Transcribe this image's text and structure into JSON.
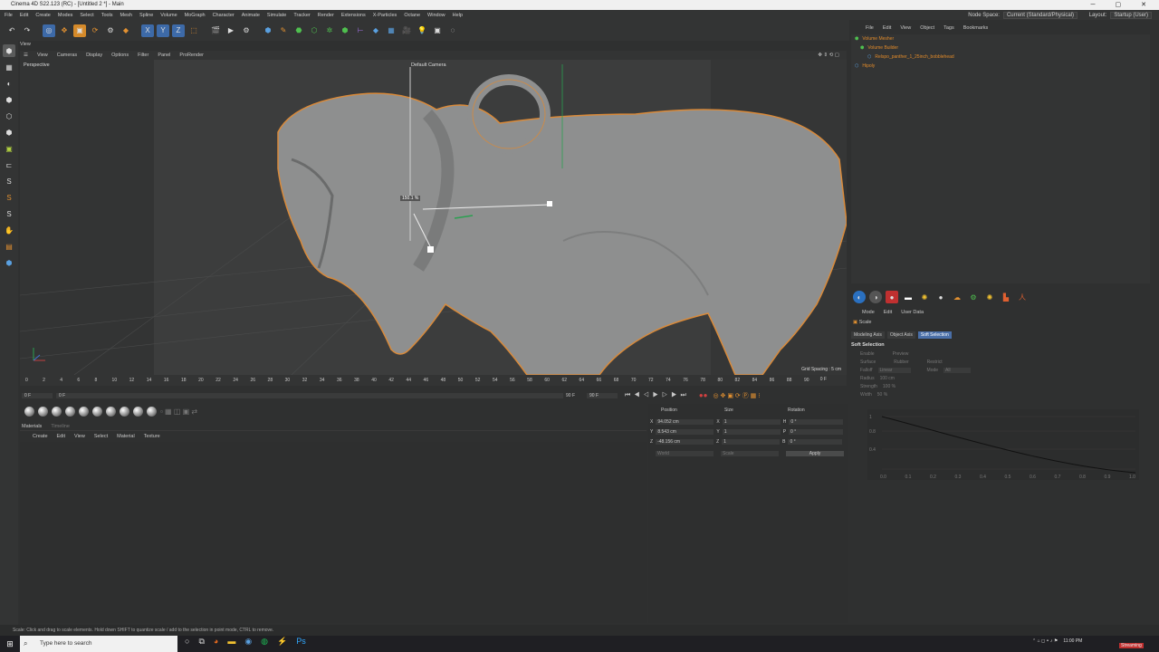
{
  "window": {
    "title": "Cinema 4D S22.123 (RC) - [Untitled 2 *] - Main"
  },
  "menu": [
    "File",
    "Edit",
    "Create",
    "Modes",
    "Select",
    "Tools",
    "Mesh",
    "Spline",
    "Volume",
    "MoGraph",
    "Character",
    "Animate",
    "Simulate",
    "Tracker",
    "Render",
    "Extensions",
    "X-Particles",
    "Octane",
    "Window",
    "Help"
  ],
  "node_space": {
    "label": "Node Space:",
    "value": "Current (Standard/Physical)"
  },
  "layout": {
    "label": "Layout:",
    "value": "Startup (User)"
  },
  "view_tab": "View",
  "viewport_menu": [
    "View",
    "Cameras",
    "Display",
    "Options",
    "Filter",
    "Panel",
    "ProRender"
  ],
  "viewport": {
    "label": "Perspective",
    "camera": "Default Camera",
    "scale_readout": "150.1 %",
    "grid_spacing": "Grid Spacing : 5 cm"
  },
  "timeline": {
    "ticks": [
      "0",
      "2",
      "4",
      "6",
      "8",
      "10",
      "12",
      "14",
      "16",
      "18",
      "20",
      "22",
      "24",
      "26",
      "28",
      "30",
      "32",
      "34",
      "36",
      "38",
      "40",
      "42",
      "44",
      "46",
      "48",
      "50",
      "52",
      "54",
      "56",
      "58",
      "60",
      "62",
      "64",
      "66",
      "68",
      "70",
      "72",
      "74",
      "76",
      "78",
      "80",
      "82",
      "84",
      "86",
      "88",
      "90"
    ],
    "current": "0 F"
  },
  "playback": {
    "start": "0 F",
    "start2": "0 F",
    "end": "90 F",
    "end2": "90 F"
  },
  "materials": {
    "tabs": [
      "Materials",
      "Timeline"
    ],
    "menu": [
      "Create",
      "Edit",
      "View",
      "Select",
      "Material",
      "Texture"
    ]
  },
  "coords": {
    "headers": [
      "Position",
      "Size",
      "Rotation"
    ],
    "rows": [
      {
        "axis": "X",
        "pos": "94.052 cm",
        "saxis": "X",
        "size": "1",
        "raxis": "H",
        "rot": "0 °"
      },
      {
        "axis": "Y",
        "pos": "8.543 cm",
        "saxis": "Y",
        "size": "1",
        "raxis": "P",
        "rot": "0 °"
      },
      {
        "axis": "Z",
        "pos": "-48.156 cm",
        "saxis": "Z",
        "size": "1",
        "raxis": "B",
        "rot": "0 °"
      }
    ],
    "mode1": "World",
    "mode2": "Scale",
    "apply": "Apply"
  },
  "obj_menu": [
    "File",
    "Edit",
    "View",
    "Object",
    "Tags",
    "Bookmarks"
  ],
  "objects": [
    {
      "name": "Volume Mesher",
      "indent": 0
    },
    {
      "name": "Volume Builder",
      "indent": 1
    },
    {
      "name": "Relspo_panther_1_25inch_bobblehead",
      "indent": 2
    },
    {
      "name": "Hipoly",
      "indent": 0
    }
  ],
  "attr_menu": [
    "Mode",
    "Edit",
    "User Data"
  ],
  "attr": {
    "title": "Scale",
    "tabs": [
      "Modeling Axis",
      "Object Axis",
      "Soft Selection"
    ],
    "section": "Soft Selection",
    "params": [
      "Enable",
      "Preview",
      "Surface",
      "Rubber",
      "Restrict",
      "Falloff",
      "Linear",
      "Mode",
      "All",
      "Radius",
      "100 cm",
      "Strength",
      "100 %",
      "Width",
      "50 %"
    ]
  },
  "graph": {
    "y_ticks": [
      "1",
      "0.8",
      "0.4"
    ],
    "x_ticks": [
      "0.0",
      "0.1",
      "0.2",
      "0.3",
      "0.4",
      "0.5",
      "0.6",
      "0.7",
      "0.8",
      "0.9",
      "1.0"
    ]
  },
  "status": "Scale: Click and drag to scale elements. Hold down SHIFT to quantize scale / add to the selection in point mode, CTRL to remove.",
  "taskbar": {
    "search": "Type here to search",
    "time": "11:00 PM",
    "streaming": "Streaming"
  }
}
